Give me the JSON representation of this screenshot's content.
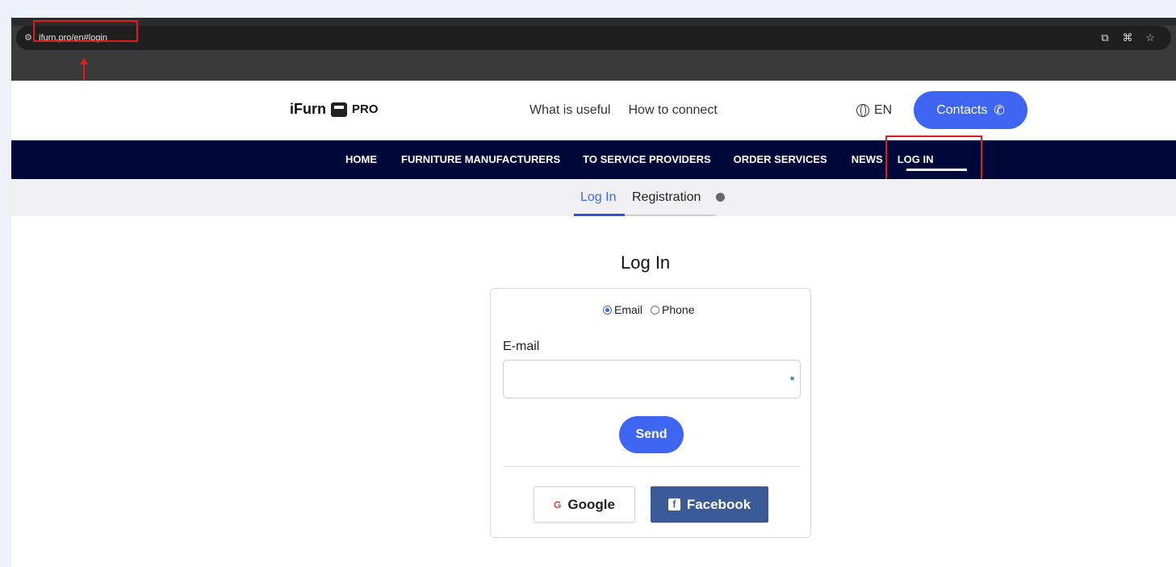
{
  "browser": {
    "url": "ifurn.pro/en#login",
    "icons": [
      "site-info-icon",
      "cast-icon",
      "translate-icon",
      "bookmark-star-icon"
    ]
  },
  "header": {
    "logo_text": "iFurn",
    "logo_suffix": "PRO",
    "links": [
      "What is useful",
      "How to connect"
    ],
    "language": "EN",
    "contacts_label": "Contacts"
  },
  "nav": {
    "items": [
      "HOME",
      "FURNITURE MANUFACTURERS",
      "TO SERVICE PROVIDERS",
      "ORDER SERVICES",
      "NEWS",
      "LOG IN"
    ]
  },
  "subtabs": {
    "login": "Log In",
    "registration": "Registration"
  },
  "form": {
    "title": "Log In",
    "radio_email": "Email",
    "radio_phone": "Phone",
    "selected": "Email",
    "email_label": "E-mail",
    "email_value": "",
    "send_label": "Send",
    "google_label": "Google",
    "facebook_label": "Facebook"
  },
  "colors": {
    "accent": "#3f66f3",
    "nav_bg": "#000839",
    "facebook": "#3b5a98",
    "annotation": "#e11b1b"
  }
}
